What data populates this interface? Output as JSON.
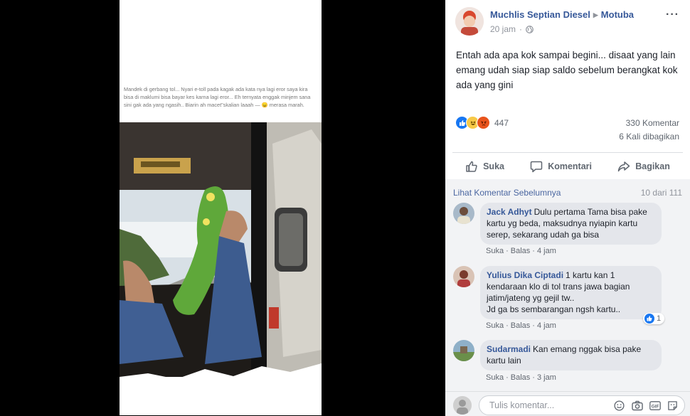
{
  "photo": {
    "caption": "Mandek di gerbang tol... Nyari e-toll pada kagak ada kata nya lagi eror saya kira bisa di maklumi bisa bayar kes karna lagi eror... Eh ternyata enggak minjem sana sini gak ada yang ngasih.. Biarin ah macet\"skalian laaah — 😠 merasa marah."
  },
  "post": {
    "author": "Muchlis Septian Diesel",
    "group": "Motuba",
    "time": "20 jam",
    "text": "Entah ada apa kok sampai begini... disaat yang lain emang udah siap siap saldo sebelum berangkat kok ada yang gini",
    "reaction_count": "447",
    "comment_count": "330 Komentar",
    "share_count": "6 Kali dibagikan"
  },
  "actions": {
    "like": "Suka",
    "comment": "Komentari",
    "share": "Bagikan"
  },
  "comments_header": {
    "prev_link": "Lihat Komentar Sebelumnya",
    "page_count": "10 dari 111"
  },
  "comments": [
    {
      "name": "Jack Adhyt",
      "text_l1": "Dulu pertama Tama bisa pake",
      "text_l2": "kartu yg beda, maksudnya nyiapin kartu",
      "text_l3": "serep, sekarang udah ga bisa",
      "like": "Suka",
      "reply": "Balas",
      "time": "4 jam"
    },
    {
      "name": "Yulius Dika Ciptadi",
      "text_l1": "1 kartu kan 1",
      "text_l2": "kendaraan klo di tol trans jawa bagian",
      "text_l3": "jatim/jateng yg gejil tw..",
      "text_l4": "Jd ga bs sembarangan ngsh kartu..",
      "like": "Suka",
      "reply": "Balas",
      "time": "4 jam",
      "likes": "1"
    },
    {
      "name": "Sudarmadi",
      "text_l1": "Kan emang nggak bisa pake",
      "text_l2": "kartu lain",
      "like": "Suka",
      "reply": "Balas",
      "time": "3 jam"
    }
  ],
  "composer": {
    "placeholder": "Tulis komentar..."
  },
  "colors": {
    "link_blue": "#365899",
    "like_blue": "#1877f2",
    "bubble_gray": "#e4e6eb"
  }
}
